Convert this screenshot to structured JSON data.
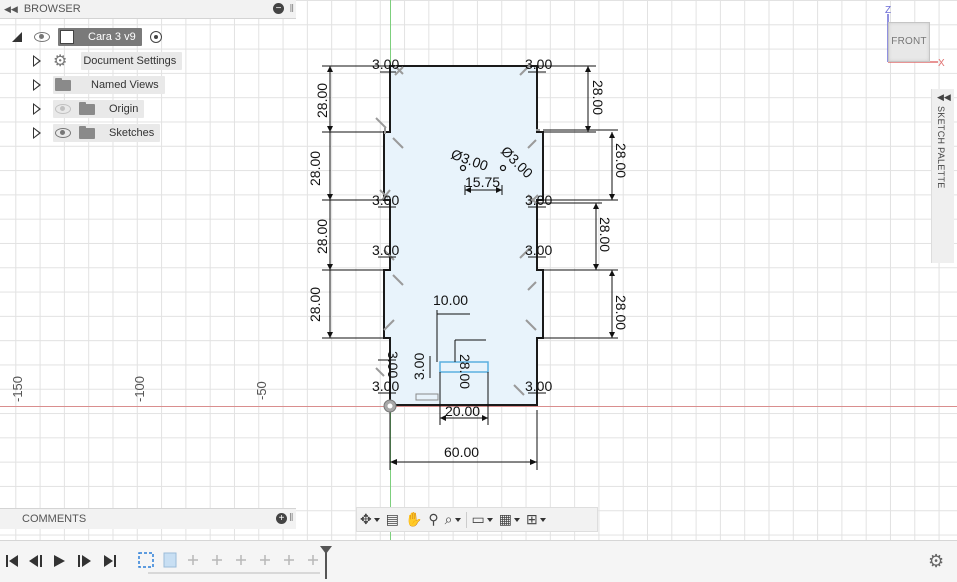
{
  "browser": {
    "title": "BROWSER",
    "items": [
      {
        "label": "Cara 3 v9"
      },
      {
        "label": "Document Settings"
      },
      {
        "label": "Named Views"
      },
      {
        "label": "Origin"
      },
      {
        "label": "Sketches"
      }
    ]
  },
  "comments": {
    "title": "COMMENTS"
  },
  "viewcube": {
    "face": "FRONT",
    "axis_z": "Z",
    "axis_x": "X"
  },
  "palette": {
    "title": "SKETCH PALETTE"
  },
  "ruler": {
    "labels": [
      "-150",
      "-100",
      "-50"
    ]
  },
  "dimensions": {
    "left_28": [
      "28.00",
      "28.00",
      "28.00",
      "28.00"
    ],
    "right_28": [
      "28.00",
      "28.00",
      "28.00",
      "28.00"
    ],
    "threes_left": [
      "3.00",
      "3.00",
      "3.00",
      "3.00"
    ],
    "threes_right": [
      "3.00",
      "3.00",
      "3.00",
      "3.00"
    ],
    "hole_dia_1": "Ø3.00",
    "hole_dia_2": "Ø3.00",
    "hole_spacing": "15.75",
    "slot_offset": "10.00",
    "slot_vertical": "28.00",
    "slot_height_a": "3.00",
    "slot_height_b": "3.00",
    "slot_width": "20.00",
    "overall_width": "60.00"
  },
  "colors": {
    "grid": "#e2e2e2",
    "y_axis": "#7dcf7d",
    "x_axis": "#d98e8e",
    "profile_fill": "#e8f3fb",
    "panel": "#f2f2f2"
  }
}
